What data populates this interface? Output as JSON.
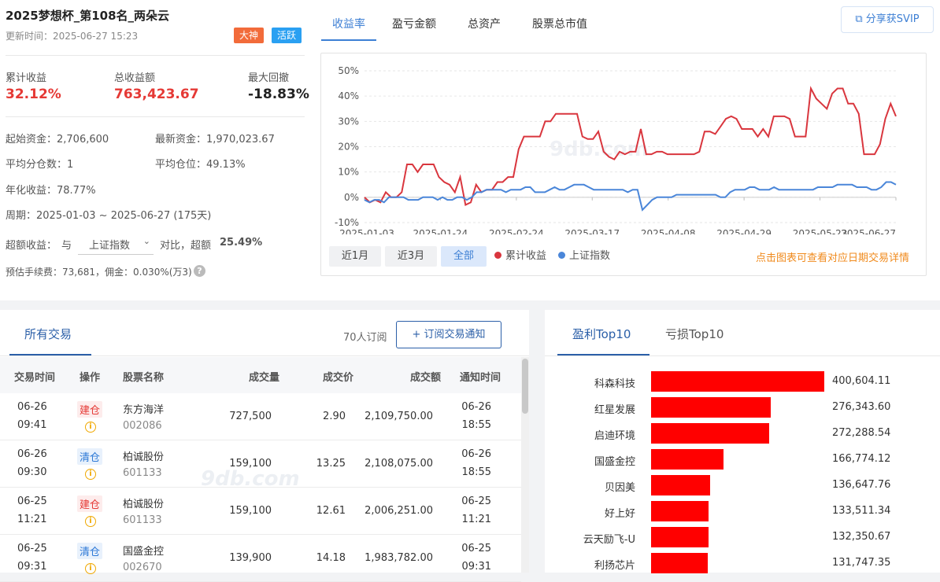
{
  "header": {
    "title": "2025梦想杯_第108名_两朵云",
    "update_time": "更新时间：2025-06-27 15:23",
    "badges": [
      "大神",
      "活跃"
    ]
  },
  "stats": {
    "cum_return_label": "累计收益",
    "cum_return_value": "32.12%",
    "total_profit_label": "总收益额",
    "total_profit_value": "763,423.67",
    "max_dd_label": "最大回撤",
    "max_dd_value": "-18.83%"
  },
  "info": {
    "start_capital": "起始资金：2,706,600",
    "latest_capital": "最新资金：1,970,023.67",
    "avg_splits": "平均分仓数：1",
    "avg_position": "平均仓位：49.13%",
    "annual_return": "年化收益：78.77%",
    "period": "周期：2025-01-03 ~ 2025-06-27 (175天)",
    "excess_label": "超额收益：",
    "excess_with": "与",
    "benchmark_select": "上证指数",
    "excess_compare": "对比，超额",
    "excess_value": "25.49%",
    "fee": "预估手续费：73,681，佣金：0.030%(万3)"
  },
  "top_tabs": [
    "收益率",
    "盈亏金额",
    "总资产",
    "股票总市值"
  ],
  "share_button": "分享获SVIP",
  "range_buttons": [
    "近1月",
    "近3月",
    "全部"
  ],
  "legend": [
    "累计收益",
    "上证指数"
  ],
  "chart_hint": "点击图表可查看对应日期交易详情",
  "watermark": "9db.com",
  "colors": {
    "accent": "#3d7fd4",
    "red": "#e53935",
    "series_red": "#d9363e",
    "series_blue": "#4a86d9",
    "bar": "#ff0000"
  },
  "chart_data": {
    "type": "line",
    "x_ticks": [
      "2025-01-03",
      "2025-01-24",
      "2025-02-24",
      "2025-03-17",
      "2025-04-08",
      "2025-04-29",
      "2025-05-23",
      "2025-06-27"
    ],
    "y_ticks": [
      "50%",
      "40%",
      "30%",
      "20%",
      "10%",
      "0%",
      "-10%"
    ],
    "ylim": [
      -10,
      50
    ],
    "grid": true,
    "series": [
      {
        "name": "累计收益",
        "values": [
          0,
          -2,
          -1,
          -2,
          2,
          0,
          0,
          2,
          13,
          13,
          10,
          13,
          13,
          13,
          8,
          6,
          5,
          2,
          8,
          -3,
          -2,
          5,
          2,
          3,
          3,
          6,
          6,
          8,
          8,
          19,
          24,
          24,
          24,
          24,
          30,
          30,
          33,
          33,
          33,
          33,
          33,
          24,
          23,
          23,
          26,
          18,
          16,
          15,
          18,
          17,
          18,
          18,
          27,
          17,
          17,
          18,
          18,
          17,
          17,
          17,
          17,
          17,
          17,
          18,
          26,
          26,
          25,
          28,
          31,
          32,
          31,
          27,
          27,
          27,
          24,
          27,
          24,
          32,
          32,
          32,
          31,
          24,
          24,
          24,
          43,
          39,
          37,
          35,
          41,
          43,
          43,
          37,
          37,
          33,
          17,
          17,
          17,
          21,
          31,
          37,
          32
        ]
      },
      {
        "name": "上证指数",
        "values": [
          -1,
          -2,
          -1,
          -1,
          -2,
          0,
          0,
          0,
          0,
          -1,
          -1,
          -1,
          0,
          0,
          0,
          -1,
          0,
          -1,
          -1,
          0,
          0,
          -1,
          0,
          2,
          2,
          3,
          3,
          3,
          3,
          2,
          3,
          3,
          3,
          4,
          4,
          2,
          2,
          2,
          3,
          4,
          3,
          3,
          4,
          5,
          5,
          5,
          4,
          3,
          3,
          3,
          3,
          3,
          3,
          3,
          2,
          3,
          3,
          -5,
          -3,
          -1,
          0,
          0,
          0,
          0,
          1,
          1,
          1,
          1,
          1,
          1,
          1,
          1,
          1,
          0,
          0,
          2,
          3,
          3,
          3,
          4,
          4,
          3,
          3,
          3,
          4,
          3,
          3,
          3,
          3,
          3,
          3,
          3,
          3,
          4,
          4,
          4,
          4,
          5,
          5,
          5,
          5,
          4,
          4,
          4,
          3,
          3,
          4,
          6,
          6,
          5
        ]
      }
    ]
  },
  "trades": {
    "tab": "所有交易",
    "subscribers": "70人订阅",
    "subscribe_button": "订阅交易通知",
    "columns": [
      "交易时间",
      "操作",
      "股票名称",
      "成交量",
      "成交价",
      "成交额",
      "通知时间"
    ],
    "rows": [
      {
        "date": "06-26",
        "time": "09:41",
        "op": "建仓",
        "name": "东方海洋",
        "code": "002086",
        "volume": "727,500",
        "price": "2.90",
        "amount": "2,109,750.00",
        "ndate": "06-26",
        "ntime": "18:55"
      },
      {
        "date": "06-26",
        "time": "09:30",
        "op": "清仓",
        "name": "柏诚股份",
        "code": "601133",
        "volume": "159,100",
        "price": "13.25",
        "amount": "2,108,075.00",
        "ndate": "06-26",
        "ntime": "18:55"
      },
      {
        "date": "06-25",
        "time": "11:21",
        "op": "建仓",
        "name": "柏诚股份",
        "code": "601133",
        "volume": "159,100",
        "price": "12.61",
        "amount": "2,006,251.00",
        "ndate": "06-25",
        "ntime": "11:21"
      },
      {
        "date": "06-25",
        "time": "09:31",
        "op": "清仓",
        "name": "国盛金控",
        "code": "002670",
        "volume": "139,900",
        "price": "14.18",
        "amount": "1,983,782.00",
        "ndate": "06-25",
        "ntime": "09:31"
      }
    ]
  },
  "top10": {
    "tabs": [
      "盈利Top10",
      "亏损Top10"
    ],
    "items": [
      {
        "name": "科森科技",
        "value": 400604.11,
        "label": "400,604.11"
      },
      {
        "name": "红星发展",
        "value": 276343.6,
        "label": "276,343.60"
      },
      {
        "name": "启迪环境",
        "value": 272288.54,
        "label": "272,288.54"
      },
      {
        "name": "国盛金控",
        "value": 166774.12,
        "label": "166,774.12"
      },
      {
        "name": "贝因美",
        "value": 136647.76,
        "label": "136,647.76"
      },
      {
        "name": "好上好",
        "value": 133511.34,
        "label": "133,511.34"
      },
      {
        "name": "云天励飞-U",
        "value": 132350.67,
        "label": "132,350.67"
      },
      {
        "name": "利扬芯片",
        "value": 131747.35,
        "label": "131,747.35"
      }
    ]
  }
}
